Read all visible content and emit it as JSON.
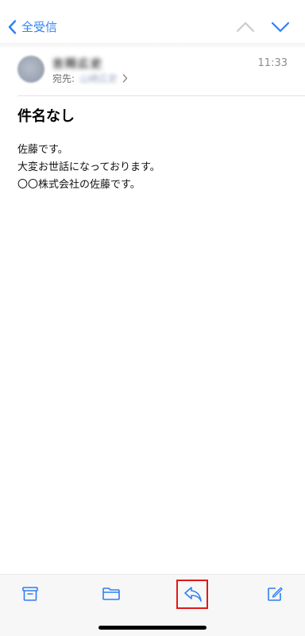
{
  "nav": {
    "back_label": "全受信",
    "accent_color": "#2f7ff6"
  },
  "message": {
    "sender_name": "吉岡広史",
    "to_label": "宛先:",
    "to_value": "山崎広史",
    "time": "11:33",
    "subject": "件名なし",
    "body_lines": [
      "佐藤です。",
      "大変お世話になっております。",
      "〇〇株式会社の佐藤です。"
    ]
  },
  "toolbar": {
    "items": [
      "archive-icon",
      "folder-icon",
      "reply-icon",
      "compose-icon"
    ],
    "highlight_color": "#e01818"
  }
}
